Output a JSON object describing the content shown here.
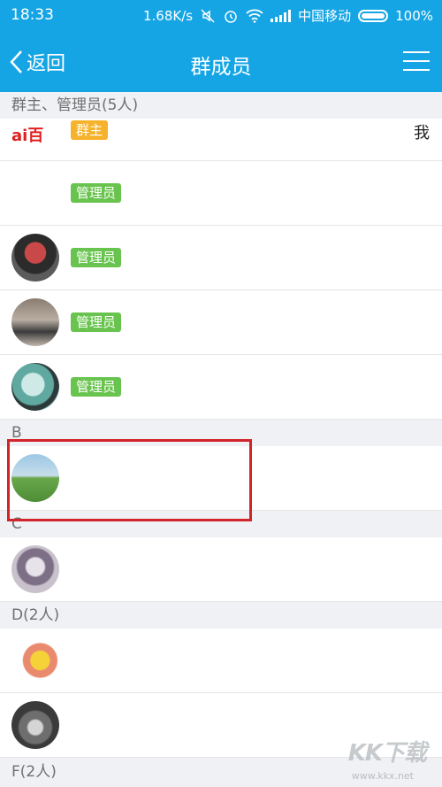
{
  "status": {
    "time": "18:33",
    "speed": "1.68K/s",
    "carrier": "中国移动",
    "battery": "100%"
  },
  "nav": {
    "back_label": "返回",
    "title": "群成员"
  },
  "sections": {
    "admins_header": "群主、管理员(5人)",
    "b_header": "B",
    "c_header": "C",
    "d_header": "D(2人)",
    "f_header": "F(2人)"
  },
  "members": {
    "owner_tag": "群主",
    "owner_me": "我",
    "admin_tag": "管理员",
    "logo_text": "ai百"
  },
  "watermark": {
    "brand": "KK下载",
    "url": "www.kkx.net"
  },
  "colors": {
    "header_blue": "#15a5e4",
    "owner_tag": "#f7b22b",
    "admin_tag": "#68c44e",
    "highlight": "#d2242b"
  }
}
